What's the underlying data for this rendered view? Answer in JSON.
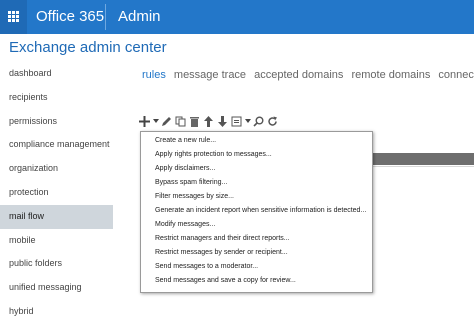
{
  "header": {
    "brand": "Office 365",
    "app": "Admin"
  },
  "page_title": "Exchange admin center",
  "sidebar": {
    "items": [
      {
        "label": "dashboard"
      },
      {
        "label": "recipients"
      },
      {
        "label": "permissions"
      },
      {
        "label": "compliance management"
      },
      {
        "label": "organization"
      },
      {
        "label": "protection"
      },
      {
        "label": "mail flow",
        "active": true
      },
      {
        "label": "mobile"
      },
      {
        "label": "public folders"
      },
      {
        "label": "unified messaging"
      },
      {
        "label": "hybrid"
      }
    ]
  },
  "tabs": [
    {
      "label": "rules",
      "active": true
    },
    {
      "label": "message trace"
    },
    {
      "label": "accepted domains"
    },
    {
      "label": "remote domains"
    },
    {
      "label": "connectors"
    }
  ],
  "toolbar": {
    "icons": [
      "plus-icon",
      "caret-down-icon",
      "pencil-icon",
      "copy-icon",
      "delete-icon",
      "arrow-up-icon",
      "arrow-down-icon",
      "report-icon",
      "caret-down-icon",
      "search-icon",
      "refresh-icon"
    ]
  },
  "dropdown": {
    "items": [
      {
        "label": "Create a new rule..."
      },
      {
        "label": "Apply rights protection to messages..."
      },
      {
        "label": "Apply disclaimers..."
      },
      {
        "label": "Bypass spam filtering..."
      },
      {
        "label": "Filter messages by size..."
      },
      {
        "label": "Generate an incident report when sensitive information is detected..."
      },
      {
        "label": "Modify messages..."
      },
      {
        "label": "Restrict managers and their direct reports..."
      },
      {
        "label": "Restrict messages by sender or recipient..."
      },
      {
        "label": "Send messages to a moderator..."
      },
      {
        "label": "Send messages and save a copy for review..."
      }
    ]
  },
  "colors": {
    "accent": "#2377c9",
    "nav_active": "#cfd6dc"
  }
}
